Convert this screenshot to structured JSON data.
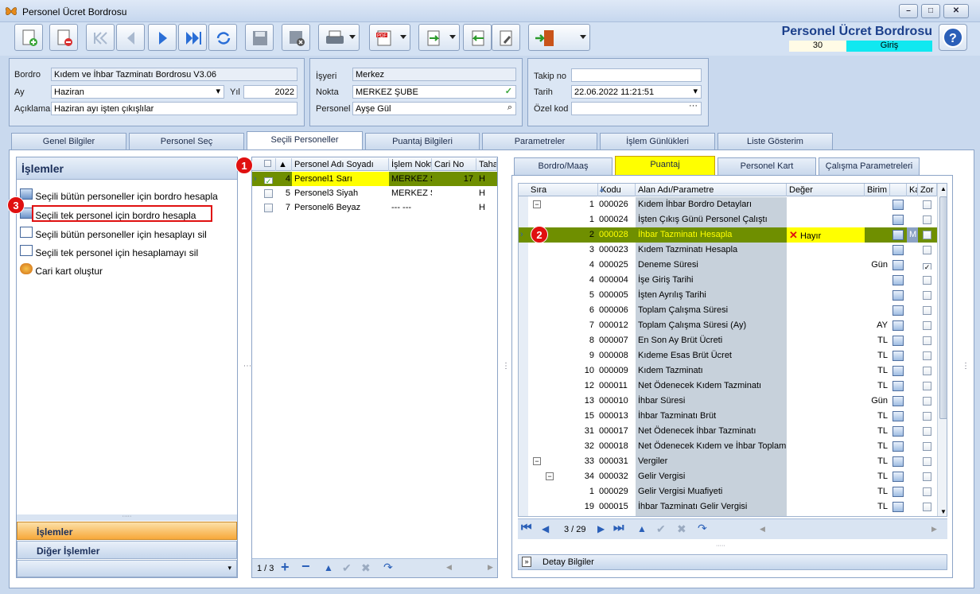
{
  "window": {
    "title": "Personel Ücret Bordrosu"
  },
  "header": {
    "title": "Personel Ücret Bordrosu",
    "number": "30",
    "status": "Giriş"
  },
  "form": {
    "bordro_label": "Bordro",
    "bordro_value": "Kıdem ve İhbar Tazminatı Bordrosu V3.06",
    "ay_label": "Ay",
    "ay_value": "Haziran",
    "yil_label": "Yıl",
    "yil_value": "2022",
    "aciklama_label": "Açıklama",
    "aciklama_value": "Haziran ayı işten çıkışlılar",
    "isyeri_label": "İşyeri",
    "isyeri_value": "Merkez",
    "nokta_label": "Nokta",
    "nokta_value": "MERKEZ ŞUBE",
    "personel_label": "Personel",
    "personel_value": "Ayşe Gül",
    "takip_label": "Takip no",
    "takip_value": "",
    "tarih_label": "Tarih",
    "tarih_value": "22.06.2022 11:21:51",
    "ozel_label": "Özel kod",
    "ozel_value": ""
  },
  "main_tabs": [
    "Genel Bilgiler",
    "Personel Seç",
    "Seçili Personeller",
    "Puantaj Bilgileri",
    "Parametreler",
    "İşlem Günlükleri",
    "Liste Gösterim"
  ],
  "left": {
    "title": "İşlemler",
    "actions": [
      "Seçili bütün personeller için bordro hesapla",
      "Seçili tek personel için bordro hesapla",
      "Seçili bütün personeller için hesaplayı sil",
      "Seçili tek personel için hesaplamayı sil",
      "Cari kart oluştur"
    ],
    "bottom_tabs": [
      "İşlemler",
      "Diğer İşlemler"
    ]
  },
  "personnel": {
    "columns": [
      "Personel Adı Soyadı",
      "İşlem Nokt",
      "Cari No",
      "Taha"
    ],
    "rows": [
      {
        "no": "4",
        "name": "Personel1 Sarı",
        "nokta": "MERKEZ Şİ",
        "cari": "17",
        "taha": "H",
        "checked": true
      },
      {
        "no": "5",
        "name": "Personel3 Siyah",
        "nokta": "MERKEZ Şİ",
        "cari": "",
        "taha": "H",
        "checked": false
      },
      {
        "no": "7",
        "name": "Personel6 Beyaz",
        "nokta": "--- ---",
        "cari": "",
        "taha": "H",
        "checked": false
      }
    ],
    "pager": "1 / 3"
  },
  "right_tabs": [
    "Bordro/Maaş",
    "Puantaj",
    "Personel Kart",
    "Çalışma Parametreleri"
  ],
  "params": {
    "columns": [
      "Sıra",
      "Kodu",
      "Alan Adı/Parametre",
      "Değer",
      "Birim",
      "Ka",
      "Zor"
    ],
    "rows": [
      {
        "sira": "1",
        "kodu": "000026",
        "ad": "Kıdem İhbar Bordro Detayları",
        "deger": "",
        "birim": "",
        "ka": "",
        "zor": false
      },
      {
        "sira": "1",
        "kodu": "000024",
        "ad": "İşten Çıkış Günü Personel Çalıştı",
        "deger": "",
        "birim": "",
        "ka": "",
        "zor": false
      },
      {
        "sira": "2",
        "kodu": "000028",
        "ad": "İhbar Tazminatı Hesapla",
        "deger": "Hayır",
        "birim": "",
        "ka": "M",
        "zor": false
      },
      {
        "sira": "3",
        "kodu": "000023",
        "ad": "Kıdem Tazminatı Hesapla",
        "deger": "",
        "birim": "",
        "ka": "",
        "zor": false
      },
      {
        "sira": "4",
        "kodu": "000025",
        "ad": "Deneme Süresi",
        "deger": "",
        "birim": "Gün",
        "ka": "",
        "zor": true
      },
      {
        "sira": "4",
        "kodu": "000004",
        "ad": "İşe Giriş Tarihi",
        "deger": "",
        "birim": "",
        "ka": "",
        "zor": false
      },
      {
        "sira": "5",
        "kodu": "000005",
        "ad": "İşten Ayrılış Tarihi",
        "deger": "",
        "birim": "",
        "ka": "",
        "zor": false
      },
      {
        "sira": "6",
        "kodu": "000006",
        "ad": "Toplam Çalışma Süresi",
        "deger": "",
        "birim": "",
        "ka": "",
        "zor": false
      },
      {
        "sira": "7",
        "kodu": "000012",
        "ad": "Toplam Çalışma Süresi (Ay)",
        "deger": "",
        "birim": "AY",
        "ka": "",
        "zor": false
      },
      {
        "sira": "8",
        "kodu": "000007",
        "ad": "En Son Ay Brüt Ücreti",
        "deger": "",
        "birim": "TL",
        "ka": "",
        "zor": false
      },
      {
        "sira": "9",
        "kodu": "000008",
        "ad": "Kıdeme Esas Brüt Ücret",
        "deger": "",
        "birim": "TL",
        "ka": "",
        "zor": false
      },
      {
        "sira": "10",
        "kodu": "000009",
        "ad": "Kıdem Tazminatı",
        "deger": "",
        "birim": "TL",
        "ka": "",
        "zor": false
      },
      {
        "sira": "12",
        "kodu": "000011",
        "ad": "Net Ödenecek Kıdem Tazminatı",
        "deger": "",
        "birim": "TL",
        "ka": "",
        "zor": false
      },
      {
        "sira": "13",
        "kodu": "000010",
        "ad": "İhbar Süresi",
        "deger": "",
        "birim": "Gün",
        "ka": "",
        "zor": false
      },
      {
        "sira": "15",
        "kodu": "000013",
        "ad": "İhbar Tazminatı Brüt",
        "deger": "",
        "birim": "TL",
        "ka": "",
        "zor": false
      },
      {
        "sira": "31",
        "kodu": "000017",
        "ad": "Net Ödenecek İhbar Tazminatı",
        "deger": "",
        "birim": "TL",
        "ka": "",
        "zor": false
      },
      {
        "sira": "32",
        "kodu": "000018",
        "ad": "Net Ödenecek Kıdem ve İhbar Toplamı",
        "deger": "",
        "birim": "TL",
        "ka": "",
        "zor": false
      },
      {
        "sira": "33",
        "kodu": "000031",
        "ad": "Vergiler",
        "deger": "",
        "birim": "TL",
        "ka": "",
        "zor": false
      },
      {
        "sira": "34",
        "kodu": "000032",
        "ad": "Gelir Vergisi",
        "deger": "",
        "birim": "TL",
        "ka": "",
        "zor": false
      },
      {
        "sira": "1",
        "kodu": "000029",
        "ad": "Gelir Vergisi Muafiyeti",
        "deger": "",
        "birim": "TL",
        "ka": "",
        "zor": false
      },
      {
        "sira": "19",
        "kodu": "000015",
        "ad": "İhbar Tazminatı Gelir Vergisi",
        "deger": "",
        "birim": "TL",
        "ka": "",
        "zor": false
      }
    ],
    "pager": "3 / 29",
    "detay": "Detay Bilgiler"
  },
  "badges": [
    "1",
    "2",
    "3"
  ],
  "colors": {
    "highlight": "#ffff00",
    "selected": "#6f8f00",
    "accent": "#10e8f0",
    "badge": "#e01010"
  }
}
